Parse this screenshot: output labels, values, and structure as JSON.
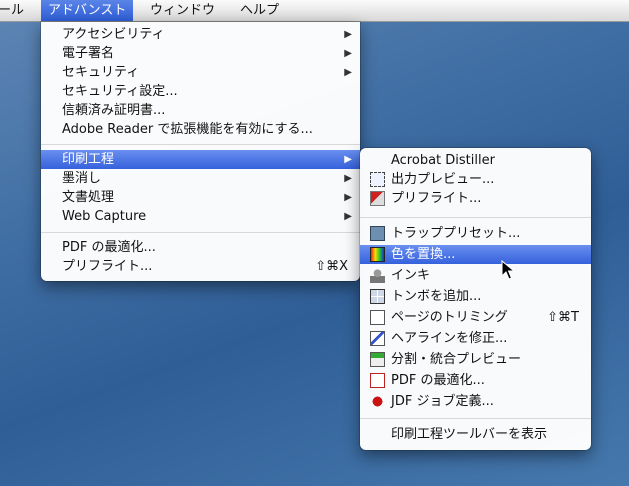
{
  "menubar": {
    "items": [
      {
        "label": "ツール"
      },
      {
        "label": "アドバンスト"
      },
      {
        "label": "ウィンドウ"
      },
      {
        "label": "ヘルプ"
      }
    ]
  },
  "main_menu": {
    "items": [
      {
        "label": "アクセシビリティ",
        "arrow": "▶"
      },
      {
        "label": "電子署名",
        "arrow": "▶"
      },
      {
        "label": "セキュリティ",
        "arrow": "▶"
      },
      {
        "label": "セキュリティ設定..."
      },
      {
        "label": "信頼済み証明書..."
      },
      {
        "label": "Adobe Reader で拡張機能を有効にする..."
      },
      {
        "label": "印刷工程",
        "arrow": "▶"
      },
      {
        "label": "墨消し",
        "arrow": "▶"
      },
      {
        "label": "文書処理",
        "arrow": "▶"
      },
      {
        "label": "Web Capture",
        "arrow": "▶"
      },
      {
        "label": "PDF の最適化..."
      },
      {
        "label": "プリフライト...",
        "shortcut": "⇧⌘X"
      }
    ]
  },
  "submenu": {
    "items": [
      {
        "label": "Acrobat Distiller"
      },
      {
        "label": "出力プレビュー...",
        "icon": "output-preview-icon"
      },
      {
        "label": "プリフライト...",
        "icon": "preflight-icon"
      },
      {
        "label": "トラッププリセット...",
        "icon": "trap-presets-icon"
      },
      {
        "label": "色を置換...",
        "icon": "convert-colors-icon"
      },
      {
        "label": "インキ",
        "icon": "ink-manager-icon"
      },
      {
        "label": "トンボを追加...",
        "icon": "printer-marks-icon"
      },
      {
        "label": "ページのトリミング",
        "icon": "crop-pages-icon",
        "shortcut": "⇧⌘T"
      },
      {
        "label": "ヘアラインを修正...",
        "icon": "fix-hairlines-icon"
      },
      {
        "label": "分割・統合プレビュー",
        "icon": "flattener-preview-icon"
      },
      {
        "label": "PDF の最適化...",
        "icon": "pdf-optimizer-icon"
      },
      {
        "label": "JDF ジョブ定義...",
        "icon": "jdf-job-definitions-icon"
      },
      {
        "label": "印刷工程ツールバーを表示"
      }
    ]
  }
}
